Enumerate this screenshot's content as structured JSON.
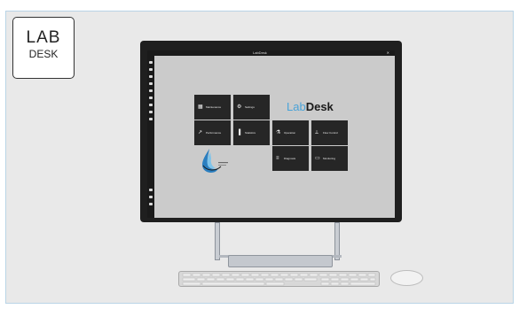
{
  "logo": {
    "line1": "LAB",
    "line2": "DESK"
  },
  "screen": {
    "topbar_title": "LabDesk",
    "topbar_right": "✕",
    "brand": {
      "part1": "Lab",
      "part2": "Desk"
    },
    "tiles": [
      {
        "icon": "grid-icon",
        "glyph": "▦",
        "label": "Maintenance"
      },
      {
        "icon": "gear-icon",
        "glyph": "⚙",
        "label": "Settings"
      },
      {
        "icon": "line-chart-icon",
        "glyph": "↗",
        "label": "Performance"
      },
      {
        "icon": "bar-chart-icon",
        "glyph": "▐",
        "label": "Statistics"
      },
      {
        "icon": "flask-icon",
        "glyph": "⚗",
        "label": "Operation"
      },
      {
        "icon": "pump-icon",
        "glyph": "⟂",
        "label": "Flow Control"
      },
      {
        "icon": "levels-icon",
        "glyph": "≡",
        "label": "Diagnosis"
      },
      {
        "icon": "tablet-icon",
        "glyph": "▭",
        "label": "Monitoring"
      }
    ]
  },
  "colors": {
    "accent": "#4aa3d8",
    "tile": "#262626",
    "screen": "#cbcbcb"
  }
}
